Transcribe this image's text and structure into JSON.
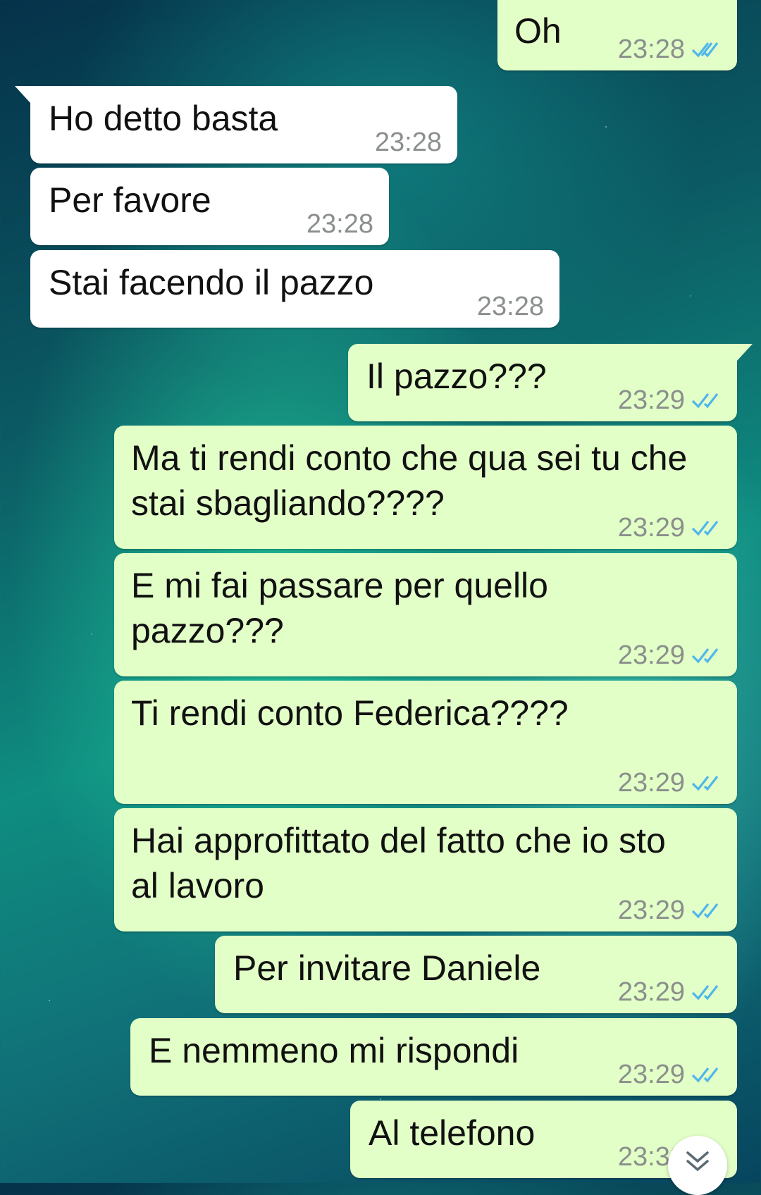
{
  "colors": {
    "incoming_bubble": "#ffffff",
    "outgoing_bubble": "#e2ffc7",
    "read_ticks": "#4fb6ec",
    "timestamp": "#8a8f8c"
  },
  "messages": [
    {
      "direction": "out",
      "text": "Oh",
      "time": "23:28",
      "status": "read"
    },
    {
      "direction": "in",
      "text": "Ho detto basta",
      "time": "23:28"
    },
    {
      "direction": "in",
      "text": "Per favore",
      "time": "23:28"
    },
    {
      "direction": "in",
      "text": "Stai facendo il pazzo",
      "time": "23:28"
    },
    {
      "direction": "out",
      "text": "Il pazzo???",
      "time": "23:29",
      "status": "read"
    },
    {
      "direction": "out",
      "text": "Ma ti rendi conto che qua sei tu che stai sbagliando????",
      "time": "23:29",
      "status": "read"
    },
    {
      "direction": "out",
      "text": "E mi fai passare per quello pazzo???",
      "time": "23:29",
      "status": "read"
    },
    {
      "direction": "out",
      "text": "Ti rendi conto Federica????",
      "time": "23:29",
      "status": "read"
    },
    {
      "direction": "out",
      "text": "Hai approfittato del fatto che io sto al lavoro",
      "time": "23:29",
      "status": "read"
    },
    {
      "direction": "out",
      "text": "Per invitare Daniele",
      "time": "23:29",
      "status": "read"
    },
    {
      "direction": "out",
      "text": "E nemmeno mi rispondi",
      "time": "23:29",
      "status": "read"
    },
    {
      "direction": "out",
      "text": "Al telefono",
      "time": "23:30",
      "status": "read"
    }
  ],
  "scroll_button": {
    "icon": "double-chevron-down-icon"
  }
}
